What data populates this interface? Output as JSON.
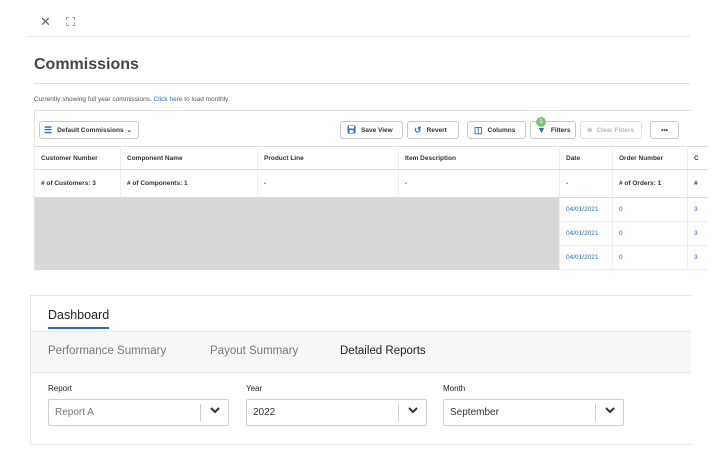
{
  "window": {
    "close_icon": "close-icon",
    "expand_icon": "expand-icon"
  },
  "page": {
    "title": "Commissions",
    "info_text": "Currently showing full year commissions. ",
    "info_link": "Click here",
    "info_suffix": " to load monthly."
  },
  "toolbar": {
    "view_select": "Default Commissions",
    "save_view": "Save View",
    "revert": "Revert",
    "columns": "Columns",
    "filters": "Filters",
    "filters_count": "1",
    "clear_filters": "Clear Filters",
    "more": "•••"
  },
  "grid": {
    "columns": [
      "Customer Number",
      "Component Name",
      "Product Line",
      "Item Description",
      "Date",
      "Order Number",
      "C"
    ],
    "summary": [
      "# of Customers: 3",
      "# of Components: 1",
      "-",
      "-",
      "-",
      "# of Orders: 1",
      "#"
    ],
    "rows": [
      {
        "date": "04/01/2021",
        "order": "0",
        "extra": "3"
      },
      {
        "date": "04/01/2021",
        "order": "0",
        "extra": "3"
      },
      {
        "date": "04/01/2021",
        "order": "0",
        "extra": "3"
      }
    ]
  },
  "dashboard": {
    "title": "Dashboard",
    "tabs": [
      "Performance Summary",
      "Payout Summary",
      "Detailed Reports"
    ],
    "active_tab": "Detailed Reports",
    "filters": {
      "report": {
        "label": "Report",
        "value": "Report A"
      },
      "year": {
        "label": "Year",
        "value": "2022"
      },
      "month": {
        "label": "Month",
        "value": "September"
      }
    }
  },
  "colors": {
    "accent": "#2a6fb5",
    "badge": "#7cc576",
    "placeholder": "#d8d8d8"
  }
}
